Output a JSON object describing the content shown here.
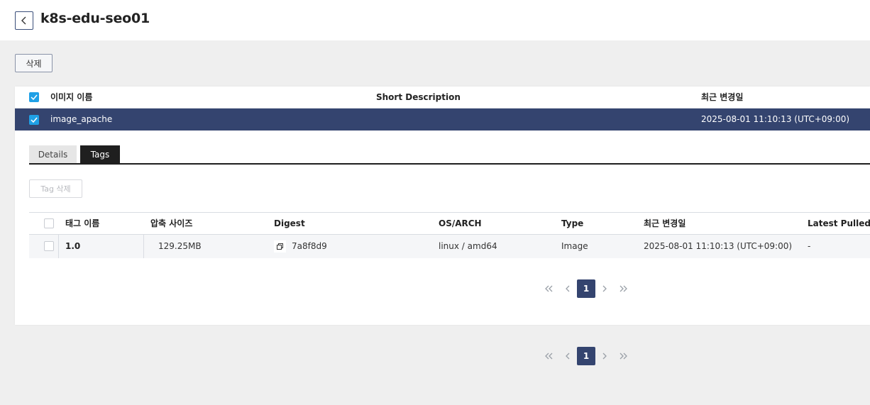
{
  "header": {
    "title": "k8s-edu-seo01",
    "back_icon": "chevron-left-icon"
  },
  "toolbar": {
    "delete_label": "삭제"
  },
  "image_table": {
    "columns": [
      "이미지 이름",
      "Short Description",
      "최근 변경일"
    ],
    "rows": [
      {
        "name": "image_apache",
        "description": "",
        "updated": "2025-08-01 11:10:13 (UTC+09:00)",
        "selected": true
      }
    ]
  },
  "detail_tabs": {
    "details_label": "Details",
    "tags_label": "Tags",
    "active": "Tags"
  },
  "tags": {
    "delete_label": "Tag 삭제",
    "columns": [
      "태그 이름",
      "압축 사이즈",
      "Digest",
      "OS/ARCH",
      "Type",
      "최근 변경일",
      "Latest Pulled"
    ],
    "rows": [
      {
        "tag": "1.0",
        "size": "129.25MB",
        "digest": "7a8f8d9",
        "os_arch": "linux / amd64",
        "type": "Image",
        "updated": "2025-08-01 11:10:13 (UTC+09:00)",
        "latest_pulled": "-"
      }
    ]
  },
  "pagination_inner": {
    "current": "1"
  },
  "pagination_outer": {
    "current": "1"
  },
  "colors": {
    "accent": "#34446f",
    "checkbox": "#1fa0e6",
    "tab_active": "#1f1f1f"
  }
}
